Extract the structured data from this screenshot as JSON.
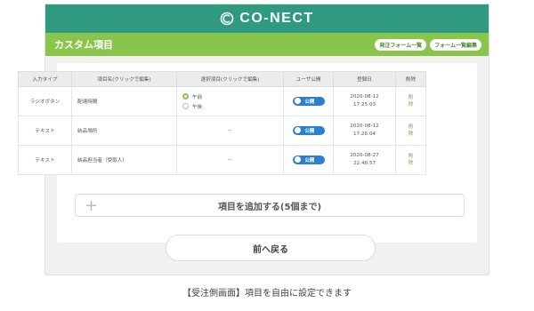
{
  "header": {
    "logo_text": "CO-NECT"
  },
  "subheader": {
    "title": "カスタム項目",
    "btn_form_list": "発注フォーム一覧",
    "btn_form_edit": "フォーム一覧編集"
  },
  "table": {
    "headers": [
      "入力タイプ",
      "項目名(クリックで編集)",
      "選択項目(クリックで編集)",
      "ユーザ公開",
      "登録日",
      "削除"
    ],
    "rows": [
      {
        "type": "ラジオボタン",
        "name": "配達時間",
        "options": [
          "午前",
          "午後"
        ],
        "public": "公開",
        "date": "2020-08-12",
        "time": "17:25:03",
        "delete": [
          "削",
          "除"
        ]
      },
      {
        "type": "テキスト",
        "name": "納品場所",
        "options": "−",
        "public": "公開",
        "date": "2020-08-12",
        "time": "17:26:04",
        "delete": [
          "削",
          "除"
        ]
      },
      {
        "type": "テキスト",
        "name": "納品担当者（受取人）",
        "options": "−",
        "public": "公開",
        "date": "2020-08-27",
        "time": "22:48:57",
        "delete": [
          "削",
          "除"
        ]
      }
    ]
  },
  "actions": {
    "add_label": "項目を追加する(5個まで)",
    "plus": "+",
    "back_label": "前へ戻る"
  },
  "caption": "【受注側画面】項目を自由に設定できます",
  "colors": {
    "header": "#2f9a7f",
    "subheader": "#8ac54b",
    "toggle": "#2b7fd1"
  }
}
